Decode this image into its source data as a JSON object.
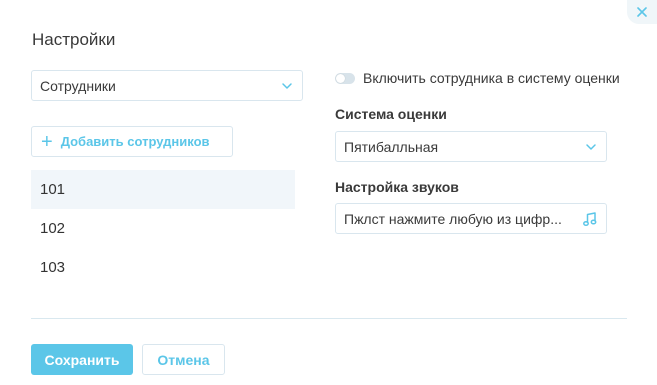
{
  "dialog": {
    "title": "Настройки"
  },
  "employees": {
    "select_value": "Сотрудники",
    "add_button_label": "Добавить сотрудников",
    "add_icon": "+",
    "items": [
      {
        "label": "101",
        "active": true
      },
      {
        "label": "102",
        "active": false
      },
      {
        "label": "103",
        "active": false
      }
    ]
  },
  "rating": {
    "toggle_label": "Включить сотрудника в систему оценки",
    "toggle_on": false,
    "system_label": "Система оценки",
    "system_value": "Пятибалльная"
  },
  "sound": {
    "label": "Настройка звуков",
    "value": "Пжлст нажмите любую из цифр..."
  },
  "footer": {
    "save_label": "Сохранить",
    "cancel_label": "Отмена"
  },
  "colors": {
    "accent": "#5bc6e8",
    "border": "#d9e6ee",
    "active_row": "#f1f6fa"
  },
  "icons": {
    "close": "close-icon",
    "chevron": "chevron-down-icon",
    "sound": "music-note-icon",
    "add": "plus-icon"
  }
}
